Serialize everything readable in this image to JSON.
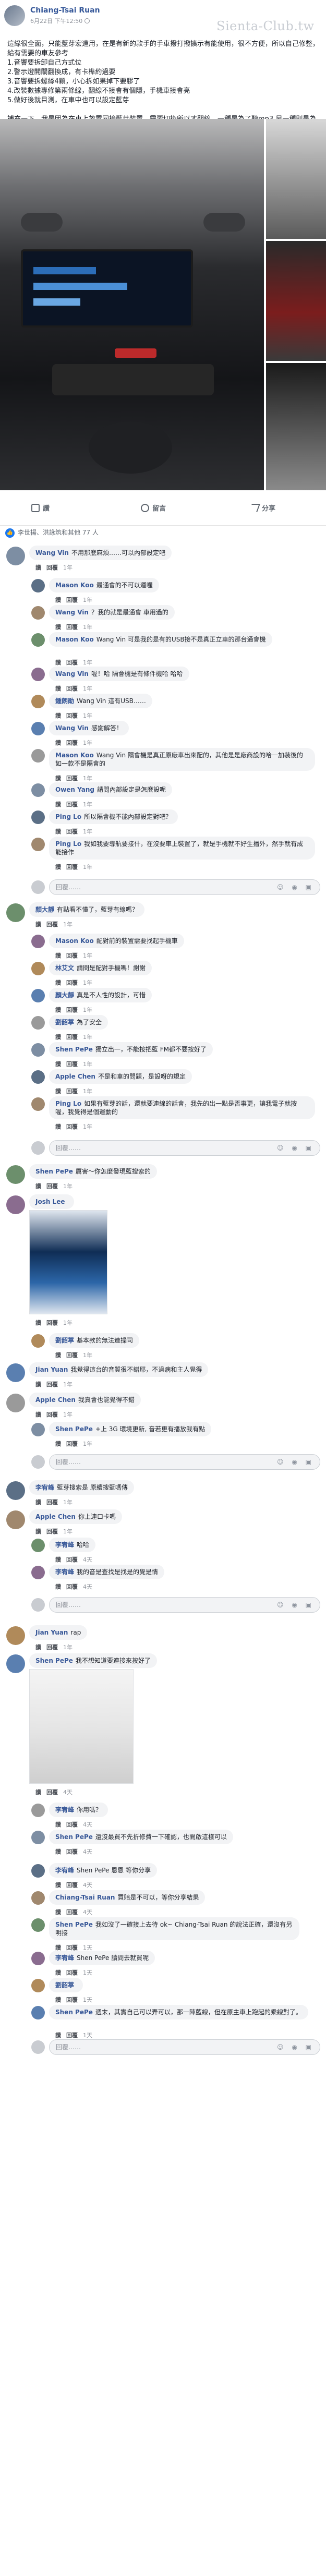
{
  "post": {
    "author": "Chiang-Tsai Ruan",
    "time": "6月22日 下午12:50",
    "watermark": "Sienta-Club.tw",
    "body": "這綠很全面，只能藍芽宏遠用，在是有新的款手的手車撥打撥擴示有能使用，很不方便，所以自己修整，給有需要的車友參考\n1.音響要拆卸自己方式位\n2.警示燈開關翻換成，有卡榫約過要\n3.音響要拆螺絲4顆，小心拆如果掉下要膠了\n4.改裝數據專修第兩條線，翻線不接會有個隱，手機車接會亮\n5.做好後就目測，在車中也可以設定藍芽\n\n補充一下，我是因為在車上放置同接藍芽裝置，需要切換所以才翻線，一種是為了聽mp3,另一種則是為了小孩無法接聽的平板"
  },
  "actions": {
    "like": "讚",
    "comment": "留言",
    "share": "分享"
  },
  "reactions": {
    "text": "李世揚、洪詠筑和其他 77 人"
  },
  "reply_placeholder": "回覆……",
  "comments": [
    {
      "name": "Wang Vin",
      "text": "不用那麼麻煩……可以內部設定吧",
      "meta": [
        "讚",
        "回覆",
        "1年"
      ]
    },
    {
      "name": "Mason Koo",
      "text": "最通會的不可以運喔",
      "meta": [
        "讚",
        "回覆",
        "1年"
      ]
    },
    {
      "name": "Wang Vin",
      "text": "？我的就是最通會 車用過的",
      "meta": [
        "讚",
        "回覆",
        "1年"
      ]
    },
    {
      "name": "Mason Koo",
      "text": "Wang Vin 可是我的是有的USB接不是真正立車的那台通會機",
      "meta": [
        "讚",
        "回覆",
        "1年"
      ]
    },
    {
      "name": "Wang Vin",
      "text": "喔！哈 隔會機是有條件機哈 哈哈",
      "meta": [
        "讚",
        "回覆",
        "1年"
      ]
    },
    {
      "name": "鍾朗勛",
      "text": "Wang Vin 這有USB……",
      "meta": [
        "讚",
        "回覆",
        "1年"
      ]
    },
    {
      "name": "Wang Vin",
      "text": "感謝解答！",
      "meta": [
        "讚",
        "回覆",
        "1年"
      ]
    },
    {
      "name": "Mason Koo",
      "text": "Wang Vin 隔會機是真正原廠車出來配的，其他是是廠商設的哈一加裝後的如一款不是隔會的",
      "meta": [
        "讚",
        "回覆",
        "1年"
      ]
    },
    {
      "name": "Owen Yang",
      "text": "請問內部設定是怎麼設呢",
      "meta": [
        "讚",
        "回覆",
        "1年"
      ]
    },
    {
      "name": "Ping Lo",
      "text": "所以隔會機不能內部設定對吧？",
      "meta": [
        "讚",
        "回覆",
        "1年"
      ]
    },
    {
      "name": "Ping Lo",
      "text": "我如我要導航要接什，在沒要車上裝置了，就是手機就不好生播外，然手就有成能接作",
      "meta": [
        "讚",
        "回覆",
        "1年"
      ]
    },
    {
      "name": "顏大靜",
      "text": "有點看不懂了，藍芽有線嗎？",
      "meta": [
        "讚",
        "回覆",
        "1年"
      ]
    },
    {
      "name": "Mason Koo",
      "text": "配對前的裝置需要找起手機車",
      "meta": [
        "讚",
        "回覆",
        "1年"
      ]
    },
    {
      "name": "林艾文",
      "text": "請問是配對手機嗎！謝謝",
      "meta": [
        "讚",
        "回覆",
        "1年"
      ]
    },
    {
      "name": "顏大靜",
      "text": "真是不人性的設計，可惜",
      "meta": [
        "讚",
        "回覆",
        "1年"
      ]
    },
    {
      "name": "劉韶葶",
      "text": "為了安全",
      "meta": [
        "讚",
        "回覆",
        "1年"
      ]
    },
    {
      "name": "Shen PePe",
      "text": "獨立出一，不能按把藍 FM都不要按好了",
      "meta": [
        "讚",
        "回覆",
        "1年"
      ]
    },
    {
      "name": "Apple Chen",
      "text": "不是和車的問題，是設呀的規定",
      "meta": [
        "讚",
        "回覆",
        "1年"
      ]
    },
    {
      "name": "Ping Lo",
      "text": "如果有藍芽的話，還就要連線的話會，我先的出一點是否事更，讓我電子就按喔，我覺得是個運動的",
      "meta": [
        "讚",
        "回覆",
        "1年"
      ]
    },
    {
      "name": "Shen PePe",
      "text": "厲害～你怎麼發現藍搜索的",
      "meta": [
        "讚",
        "回覆",
        "1年"
      ]
    },
    {
      "name": "Josh Lee",
      "text": "",
      "meta": [
        "讚",
        "回覆",
        "1年"
      ]
    },
    {
      "name": "劉韶葶",
      "text": "基本款的無法連操司",
      "meta": [
        "讚",
        "回覆",
        "1年"
      ]
    },
    {
      "name": "Jian Yuan",
      "text": "我覺得這台的音質很不錯耶，不過病和主人覺得",
      "meta": [
        "讚",
        "回覆",
        "1年"
      ]
    },
    {
      "name": "Apple Chen",
      "text": "我真會也能覺得不錯",
      "meta": [
        "讚",
        "回覆",
        "1年"
      ]
    },
    {
      "name": "Shen PePe",
      "text": "+上 3G 環境更新, 音若更有播放我有點",
      "meta": [
        "讚",
        "回覆",
        "1年"
      ]
    },
    {
      "name": "李宥峰",
      "text": "藍芽搜索是 原續搜藍嗎傳",
      "meta": [
        "讚",
        "回覆",
        "1年"
      ]
    },
    {
      "name": "Apple Chen",
      "text": "你上連口卡嗎",
      "meta": [
        "讚",
        "回覆",
        "1年"
      ]
    },
    {
      "name": "李宥峰",
      "text": "哈哈",
      "meta": [
        "讚",
        "回覆",
        "4天"
      ]
    },
    {
      "name": "李宥峰",
      "text": "我的音是查找是找是的覺是情",
      "meta": [
        "讚",
        "回覆",
        "4天"
      ]
    },
    {
      "name": "Jian Yuan",
      "text": "rap",
      "meta": [
        "讚",
        "回覆",
        "1年"
      ]
    },
    {
      "name": "Shen PePe",
      "text": "我不想知道要連接來按好了",
      "meta": [
        "讚",
        "回覆",
        "4天"
      ]
    },
    {
      "name": "李宥峰",
      "text": "你用嗎？",
      "meta": [
        "讚",
        "回覆",
        "4天"
      ]
    },
    {
      "name": "Shen PePe",
      "text": "還沒最買不先折修費一下確認，也開啟這樣可以",
      "meta": [
        "讚",
        "回覆",
        "4天"
      ]
    },
    {
      "name": "李宥峰",
      "text": "Shen PePe 恩恩 等你分享",
      "meta": [
        "讚",
        "回覆",
        "4天"
      ]
    },
    {
      "name": "Chiang-Tsai Ruan",
      "text": "買賠是不可以，等你分享結果",
      "meta": [
        "讚",
        "回覆",
        "4天"
      ]
    },
    {
      "name": "Shen PePe",
      "text": "我如沒了一確接上去待 ok~ Chiang-Tsai Ruan 的說法正確，還沒有另明接",
      "meta": [
        "讚",
        "回覆",
        "1天"
      ]
    },
    {
      "name": "李宥峰",
      "text": "Shen PePe 讀問去就買呢",
      "meta": [
        "讚",
        "回覆",
        "1天"
      ]
    },
    {
      "name": "劉韶葶",
      "text": "",
      "meta": [
        "讚",
        "回覆",
        "1天"
      ]
    },
    {
      "name": "Shen PePe",
      "text": "週末，其實自己可以弄可以，那一陣藍線，但在原主車上跑起的乘線對了。",
      "meta": [
        "讚",
        "回覆",
        "1天"
      ]
    }
  ]
}
